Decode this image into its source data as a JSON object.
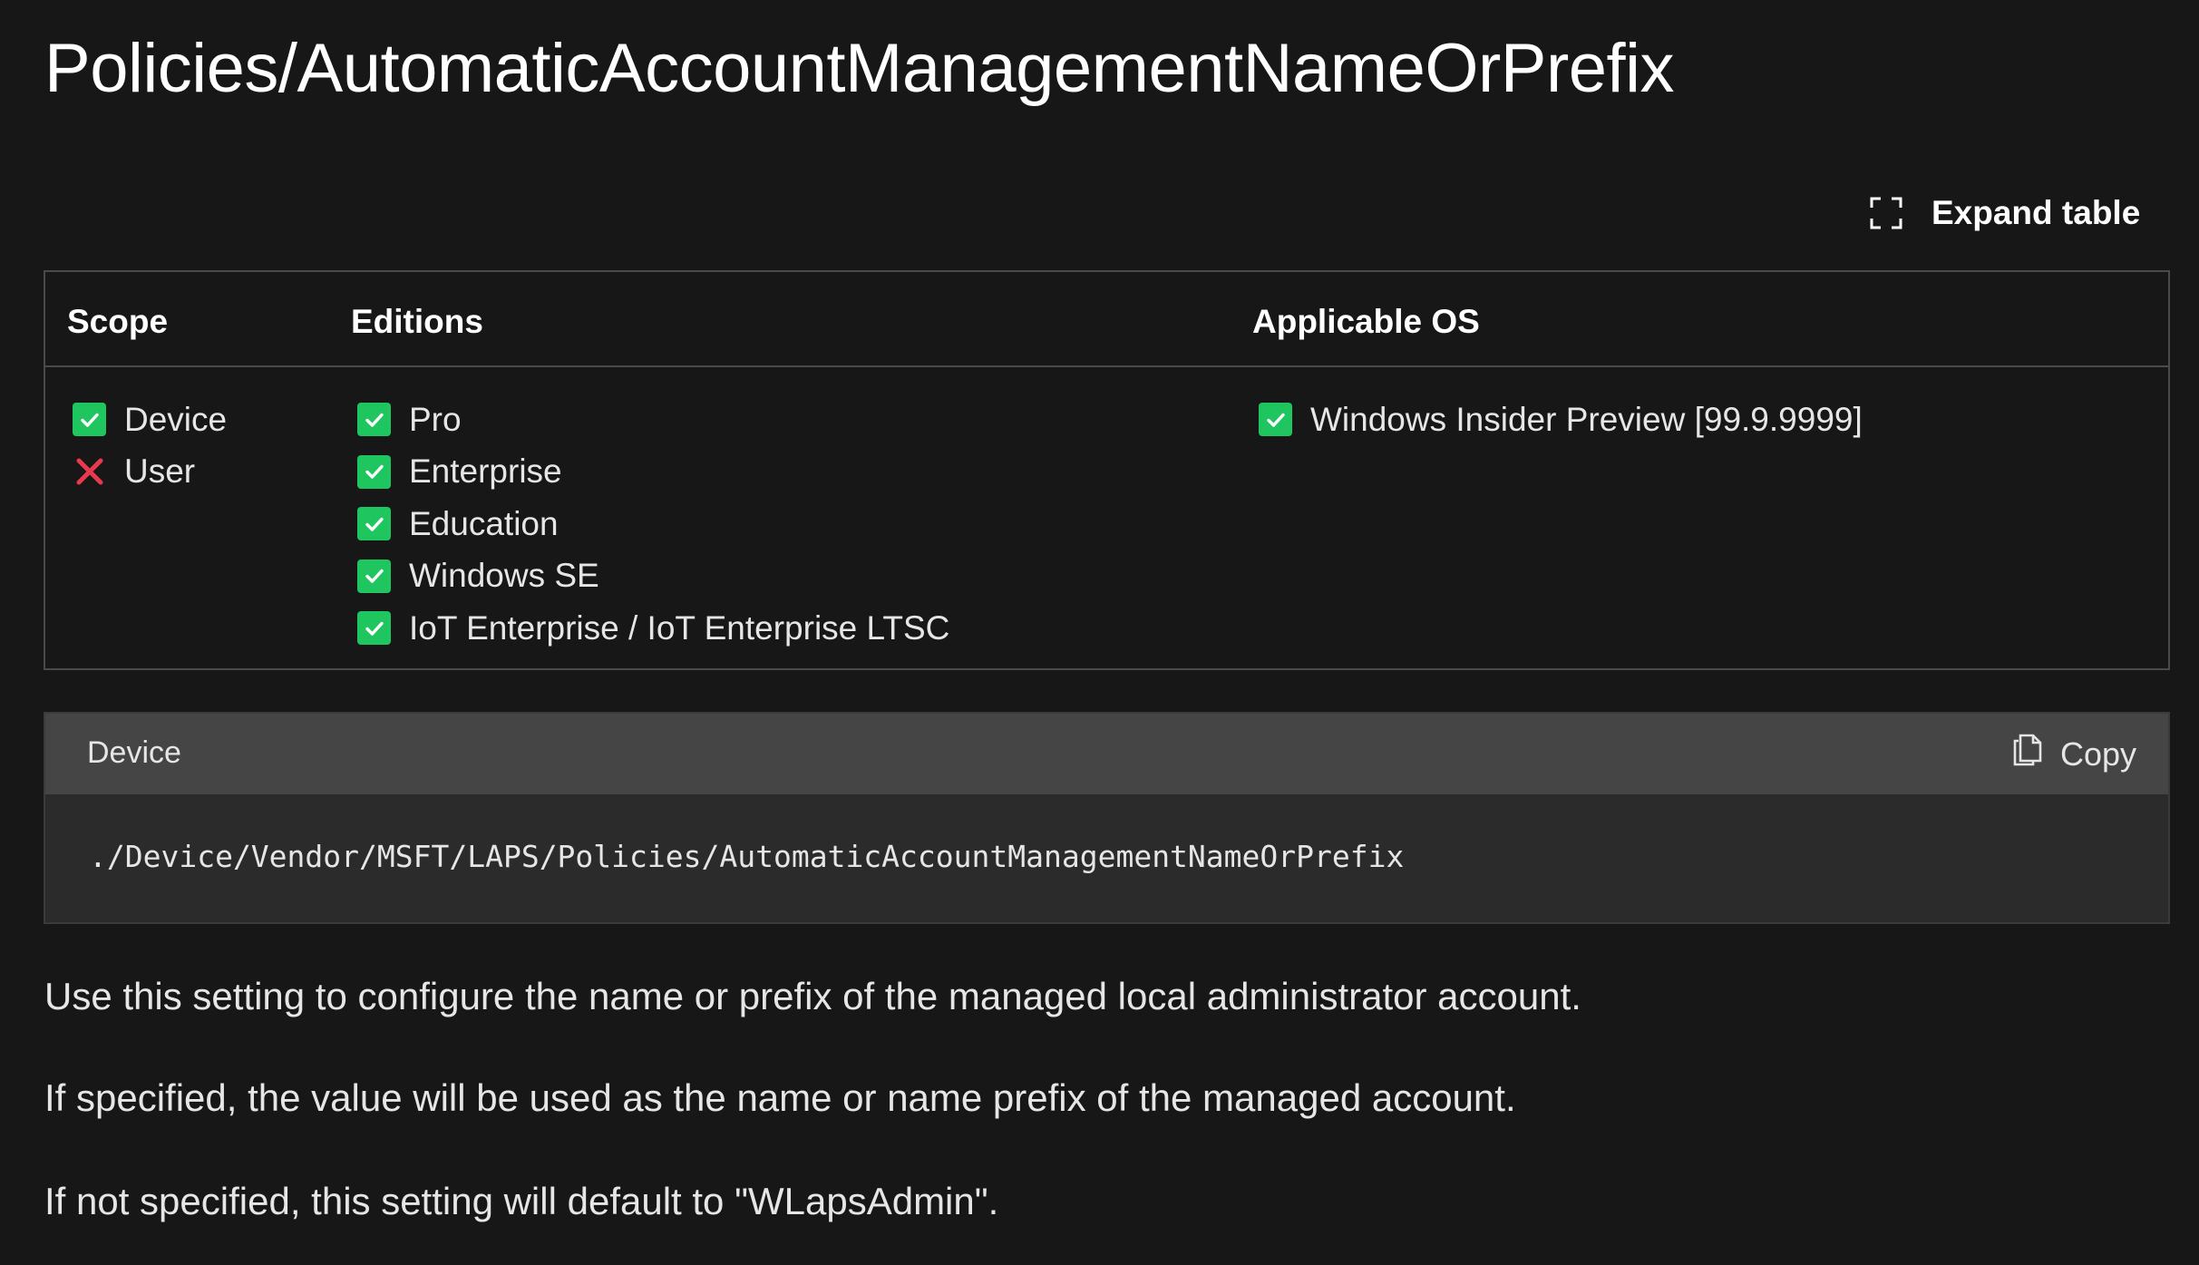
{
  "page": {
    "title": "Policies/AutomaticAccountManagementNameOrPrefix"
  },
  "toolbar": {
    "expand_table_label": "Expand table",
    "expand_icon": "expand-icon"
  },
  "table": {
    "headers": {
      "scope": "Scope",
      "editions": "Editions",
      "applicable_os": "Applicable OS"
    },
    "scope": [
      {
        "label": "Device",
        "status": "check"
      },
      {
        "label": "User",
        "status": "cross"
      }
    ],
    "editions": [
      {
        "label": "Pro",
        "status": "check"
      },
      {
        "label": "Enterprise",
        "status": "check"
      },
      {
        "label": "Education",
        "status": "check"
      },
      {
        "label": "Windows SE",
        "status": "check"
      },
      {
        "label": "IoT Enterprise / IoT Enterprise LTSC",
        "status": "check"
      }
    ],
    "applicable_os": [
      {
        "label": "Windows Insider Preview [99.9.9999]",
        "status": "check"
      }
    ]
  },
  "code": {
    "language": "Device",
    "copy_label": "Copy",
    "copy_icon": "copy-icon",
    "text": "./Device/Vendor/MSFT/LAPS/Policies/AutomaticAccountManagementNameOrPrefix"
  },
  "description": {
    "p1": "Use this setting to configure the name or prefix of the managed local administrator account.",
    "p2": "If specified, the value will be used as the name or name prefix of the managed account.",
    "p3": "If not specified, this setting will default to \"WLapsAdmin\"."
  },
  "colors": {
    "background": "#171717",
    "check": "#1fc65f",
    "cross": "#e8394d",
    "code_header": "#454545",
    "code_body": "#2b2b2b"
  }
}
